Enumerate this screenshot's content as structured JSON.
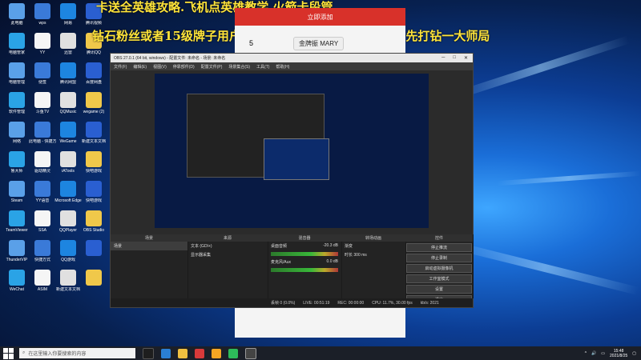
{
  "overlay": {
    "line1": "卡送全英雄攻略.飞机点英雄教学.火箭卡段管",
    "line2": "钻石粉丝或者15级牌子用户每个月包  哦，盛日点去虐妹妹  先打钻一大师局"
  },
  "phone": {
    "header": "立即添加",
    "pill": "金牌振 MARY",
    "number": "5"
  },
  "obs": {
    "title": "OBS 27.0.1 (64 bit, windows) - 配置文件: 未命名 - 场景: 未命名",
    "menu": [
      "文件(F)",
      "编辑(E)",
      "视图(V)",
      "停靠部件(D)",
      "配置文件(P)",
      "场景集合(S)",
      "工具(T)",
      "帮助(H)"
    ],
    "docks": {
      "scenes": {
        "title": "场景",
        "items": [
          "场景"
        ]
      },
      "sources": {
        "title": "来源",
        "items": [
          "文本 (GDI+)",
          "显示器采集"
        ]
      },
      "mixer": {
        "title": "混音器",
        "tracks": [
          {
            "name": "桌面音频",
            "db": "-20.3 dB"
          },
          {
            "name": "麦克风/Aux",
            "db": "0.0 dB"
          }
        ]
      },
      "transitions": {
        "title": "转场动画",
        "type": "渐变",
        "duration_label": "时长",
        "duration": "300 ms"
      },
      "controls": {
        "title": "控件",
        "buttons": [
          "停止推流",
          "停止录制",
          "启动虚拟摄像机",
          "工作室模式",
          "设置",
          "退出"
        ]
      }
    },
    "status": {
      "dropped": "丢帧 0 (0.0%)",
      "live": "LIVE: 00:51:19",
      "rec": "REC: 00:00:00",
      "cpu": "CPU: 11.7%, 30.00 fps",
      "kbs": "kb/s: 2021"
    }
  },
  "desktop_icons": [
    {
      "label": "此电脑"
    },
    {
      "label": "wps"
    },
    {
      "label": "网易"
    },
    {
      "label": "腾讯视频"
    },
    {
      "label": "电脑管家"
    },
    {
      "label": "YY"
    },
    {
      "label": "迅雷"
    },
    {
      "label": "腾讯QQ"
    },
    {
      "label": "电脑管理"
    },
    {
      "label": "便签"
    },
    {
      "label": "腾讯网盟"
    },
    {
      "label": "百度网盘"
    },
    {
      "label": "软件管理"
    },
    {
      "label": "斗鱼TV"
    },
    {
      "label": "QQMusic"
    },
    {
      "label": "wegame (2)"
    },
    {
      "label": "网络"
    },
    {
      "label": "此电脑 - 快捷方式"
    },
    {
      "label": "WeGame"
    },
    {
      "label": "新建文本文档"
    },
    {
      "label": "鲁大师"
    },
    {
      "label": "驱动精灵"
    },
    {
      "label": "iATools"
    },
    {
      "label": "快吧游戏"
    },
    {
      "label": "Steam"
    },
    {
      "label": "YY语音"
    },
    {
      "label": "Microsoft Edge"
    },
    {
      "label": "快吧游戏"
    },
    {
      "label": "TeamViewer"
    },
    {
      "label": "SSA"
    },
    {
      "label": "QQPlayer"
    },
    {
      "label": "OBS Studio"
    },
    {
      "label": "ThunderVIP"
    },
    {
      "label": "快捷方式"
    },
    {
      "label": "QQ游戏"
    },
    {
      "label": ""
    },
    {
      "label": "WeChat"
    },
    {
      "label": "ASIM"
    },
    {
      "label": "新建文本文档"
    },
    {
      "label": ""
    }
  ],
  "taskbar": {
    "search_placeholder": "在这里输入你要搜索的内容",
    "time": "15:48",
    "date": "2021/8/25"
  }
}
